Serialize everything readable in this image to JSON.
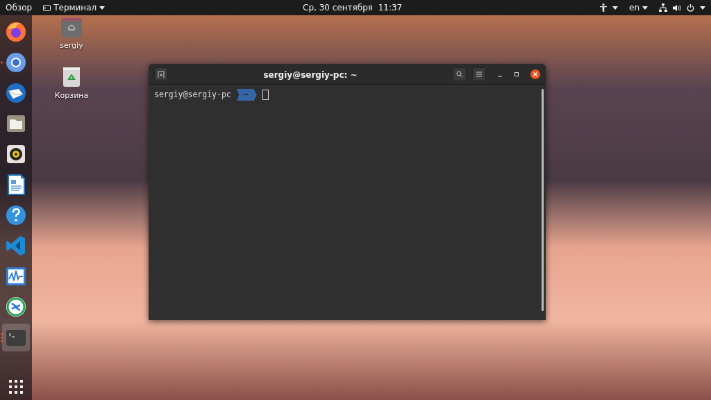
{
  "top_bar": {
    "activities": "Обзор",
    "app_menu": "Терминал",
    "clock": "Ср, 30 сентября  11:37",
    "language": "en"
  },
  "dock": [
    {
      "kind": "firefox",
      "running": false,
      "multiple_windows": false,
      "selected": false
    },
    {
      "kind": "chromium",
      "running": true,
      "multiple_windows": false,
      "selected": false
    },
    {
      "kind": "mail",
      "running": false,
      "multiple_windows": false,
      "selected": false
    },
    {
      "kind": "files",
      "running": false,
      "multiple_windows": false,
      "selected": false
    },
    {
      "kind": "music",
      "running": false,
      "multiple_windows": false,
      "selected": false
    },
    {
      "kind": "writer",
      "running": false,
      "multiple_windows": false,
      "selected": false
    },
    {
      "kind": "help",
      "running": false,
      "multiple_windows": false,
      "selected": false
    },
    {
      "kind": "code",
      "running": false,
      "multiple_windows": false,
      "selected": false
    },
    {
      "kind": "monitor",
      "running": false,
      "multiple_windows": false,
      "selected": false
    },
    {
      "kind": "remote",
      "running": false,
      "multiple_windows": false,
      "selected": false
    },
    {
      "kind": "terminal",
      "running": true,
      "multiple_windows": true,
      "selected": true
    }
  ],
  "desktop_icons": [
    {
      "kind": "home",
      "label": "sergiy"
    },
    {
      "kind": "trash",
      "label": "Корзина"
    }
  ],
  "terminal": {
    "title": "sergiy@sergiy-pc: ~",
    "prompt_user": "sergiy@sergiy-pc",
    "prompt_dir": "~"
  }
}
